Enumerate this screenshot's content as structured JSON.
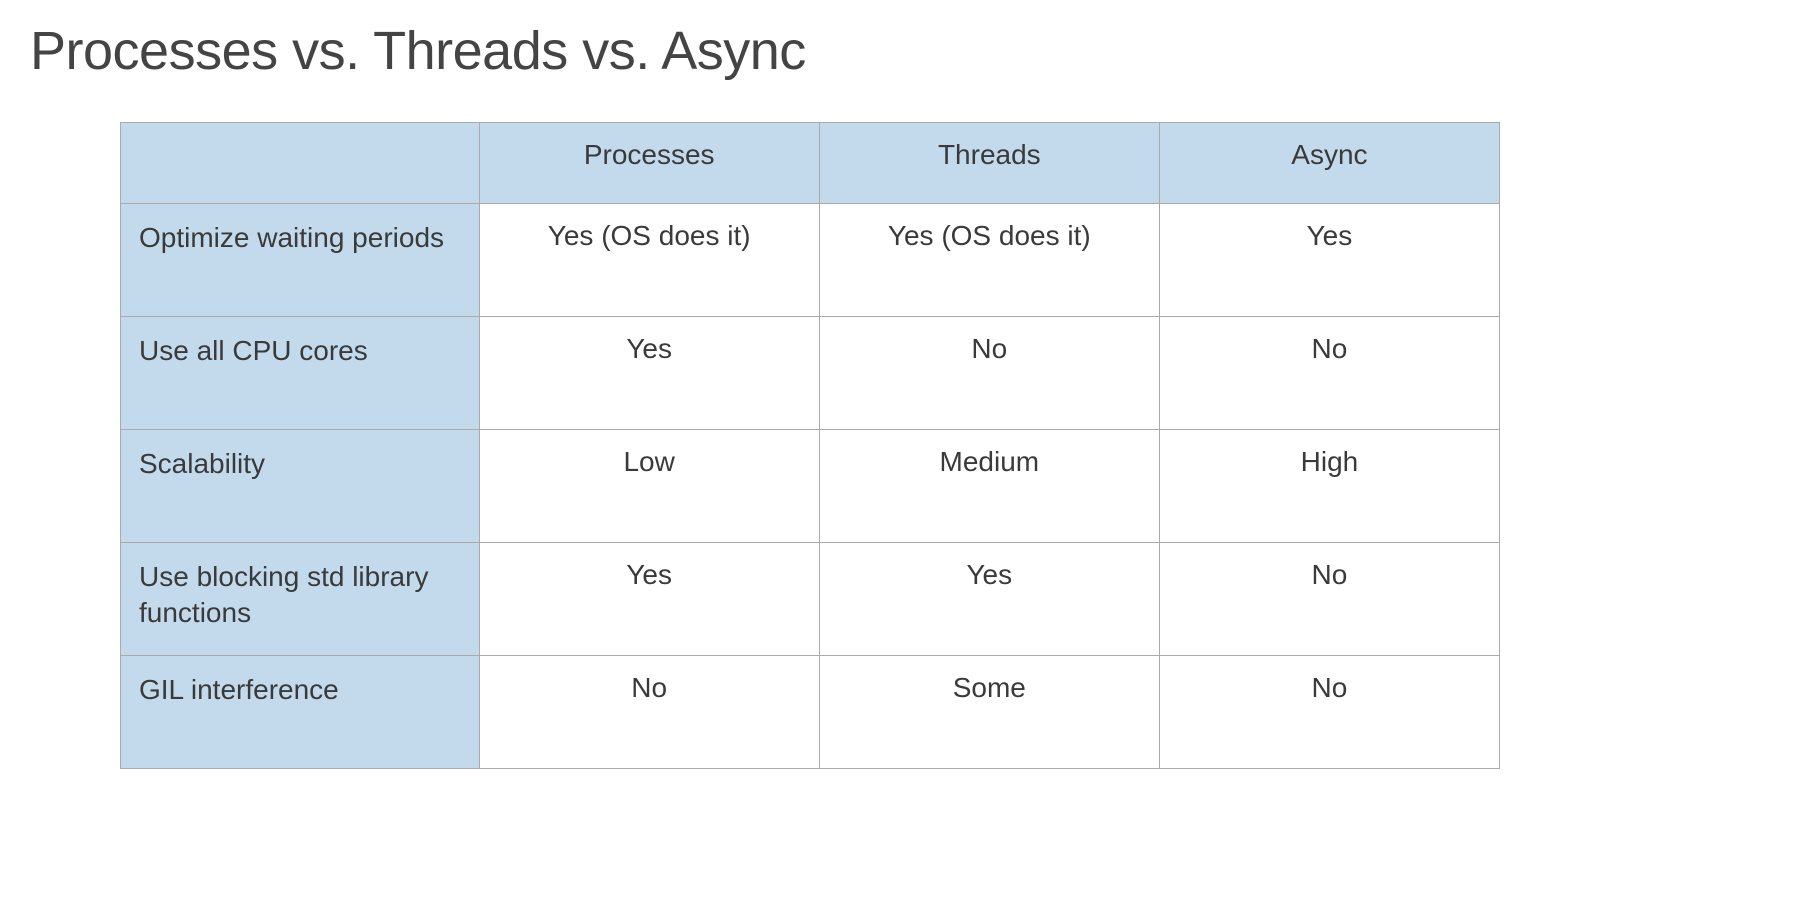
{
  "title": "Processes vs. Threads vs. Async",
  "columns": [
    "Processes",
    "Threads",
    "Async"
  ],
  "rows": [
    {
      "label": "Optimize waiting periods",
      "values": [
        "Yes (OS does it)",
        "Yes (OS does it)",
        "Yes"
      ]
    },
    {
      "label": "Use all CPU cores",
      "values": [
        "Yes",
        "No",
        "No"
      ]
    },
    {
      "label": "Scalability",
      "values": [
        "Low",
        "Medium",
        "High"
      ]
    },
    {
      "label": "Use blocking std library functions",
      "values": [
        "Yes",
        "Yes",
        "No"
      ]
    },
    {
      "label": "GIL interference",
      "values": [
        "No",
        "Some",
        "No"
      ]
    }
  ],
  "chart_data": {
    "type": "table",
    "title": "Processes vs. Threads vs. Async",
    "columns": [
      "",
      "Processes",
      "Threads",
      "Async"
    ],
    "rows": [
      [
        "Optimize waiting periods",
        "Yes (OS does it)",
        "Yes (OS does it)",
        "Yes"
      ],
      [
        "Use all CPU cores",
        "Yes",
        "No",
        "No"
      ],
      [
        "Scalability",
        "Low",
        "Medium",
        "High"
      ],
      [
        "Use blocking std library functions",
        "Yes",
        "Yes",
        "No"
      ],
      [
        "GIL interference",
        "No",
        "Some",
        "No"
      ]
    ]
  }
}
